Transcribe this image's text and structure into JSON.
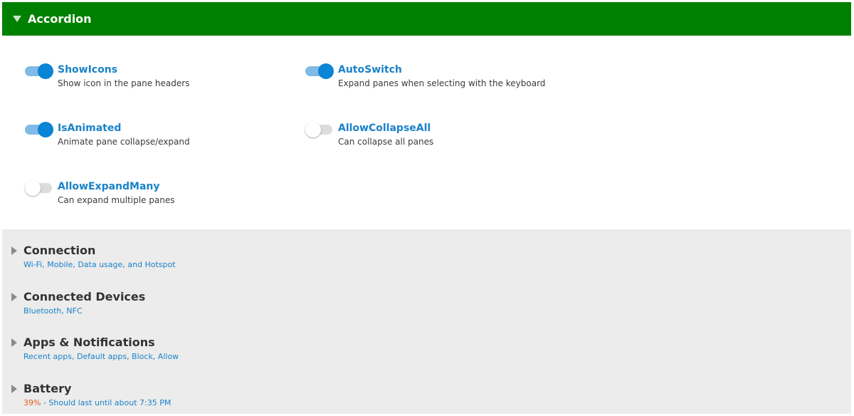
{
  "header": {
    "title": "Accordion",
    "bg": "#008000",
    "expand_icon": "triangle-down-icon"
  },
  "options": [
    {
      "name": "ShowIcons",
      "desc": "Show icon in the pane headers",
      "on": true
    },
    {
      "name": "AutoSwitch",
      "desc": "Expand panes when selecting with the keyboard",
      "on": true
    },
    {
      "name": "IsAnimated",
      "desc": "Animate pane collapse/expand",
      "on": true
    },
    {
      "name": "AllowCollapseAll",
      "desc": "Can collapse all panes",
      "on": false
    },
    {
      "name": "AllowExpandMany",
      "desc": "Can expand multiple panes",
      "on": false
    }
  ],
  "panes": [
    {
      "title": "Connection",
      "subtitle": "Wi-Fi, Mobile, Data usage, and Hotspot"
    },
    {
      "title": "Connected Devices",
      "subtitle": "Bluetooth, NFC"
    },
    {
      "title": "Apps & Notifications",
      "subtitle": "Recent apps, Default apps, Block, Allow"
    },
    {
      "title": "Battery",
      "subtitle_highlight": "39%",
      "subtitle": " - Should last until about 7:35 PM"
    }
  ],
  "colors": {
    "accent": "#0a84d4",
    "link": "#1a82c8",
    "battery_highlight": "#e05a1e",
    "pane_bg": "#ececec"
  }
}
